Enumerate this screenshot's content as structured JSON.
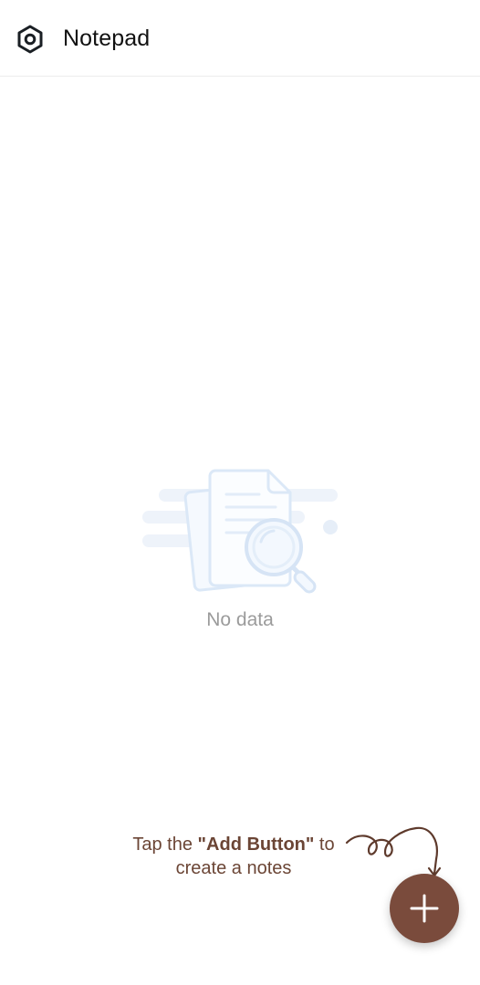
{
  "header": {
    "title": "Notepad",
    "settings_icon": "settings-gear-icon"
  },
  "empty_state": {
    "message": "No data",
    "illustration": "document-search-illustration"
  },
  "hint": {
    "prefix": "Tap the ",
    "highlight": "\"Add Button\"",
    "suffix": " to",
    "line2": "create a notes"
  },
  "fab": {
    "icon": "plus-icon"
  },
  "colors": {
    "accent": "#7a4b3c",
    "hint_text": "#6b4535",
    "muted_text": "#9b9b9b",
    "illustration": "#dbe8f7"
  }
}
